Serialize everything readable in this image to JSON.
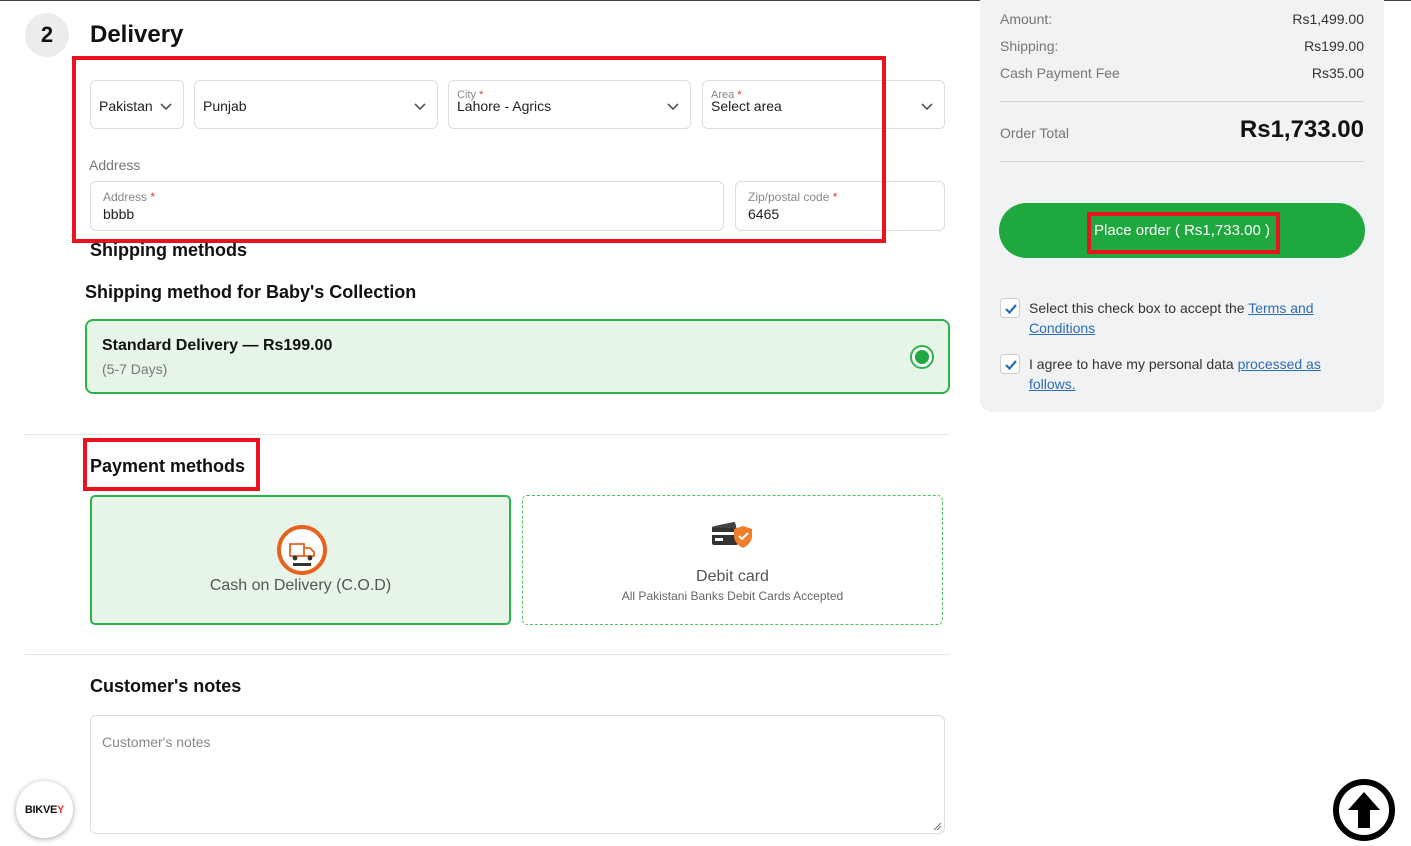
{
  "delivery": {
    "step_number": "2",
    "title": "Delivery",
    "country": "Pakistan",
    "province": "Punjab",
    "city_label": "City",
    "city": "Lahore - Agrics",
    "area_label": "Area",
    "area_placeholder": "Select area",
    "required_mark": "*",
    "address_section_label": "Address",
    "address_label": "Address",
    "address_value": "bbbb",
    "zip_label": "Zip/postal code",
    "zip_value": "6465"
  },
  "shipping": {
    "section_title": "Shipping methods",
    "vendor_title": "Shipping method for Baby's Collection",
    "option_name": "Standard Delivery — Rs199.00",
    "option_days": "(5-7 Days)"
  },
  "payment": {
    "section_title": "Payment methods",
    "cod_label": "Cash on Delivery (C.O.D)",
    "debit_label": "Debit card",
    "debit_sublabel": "All Pakistani Banks Debit Cards Accepted"
  },
  "notes": {
    "title": "Customer's notes",
    "placeholder": "Customer's notes"
  },
  "summary": {
    "amount_label": "Amount:",
    "amount_value": "Rs1,499.00",
    "shipping_label": "Shipping:",
    "shipping_value": "Rs199.00",
    "fee_label": "Cash Payment Fee",
    "fee_value": "Rs35.00",
    "total_label": "Order Total",
    "total_value": "Rs1,733.00",
    "place_order_label": "Place order ( Rs1,733.00 )",
    "terms_text": "Select this check box to accept the ",
    "terms_link": "Terms and Conditions",
    "privacy_text": "I agree to have my personal data ",
    "privacy_link": "processed as follows."
  },
  "brand": {
    "badge_text_1": "BIKVE",
    "badge_text_2": "Y"
  },
  "colors": {
    "accent_green": "#1fa83d",
    "highlight_red": "#e8131d",
    "link_blue": "#2d6db5"
  }
}
